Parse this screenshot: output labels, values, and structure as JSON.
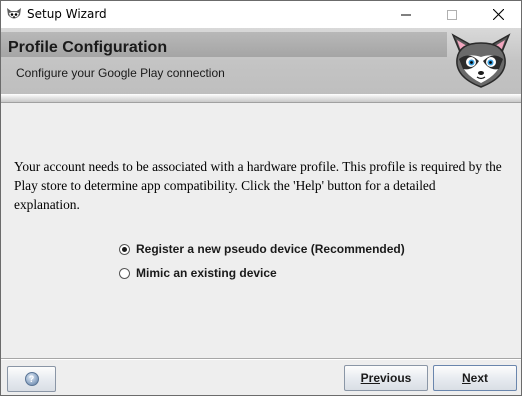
{
  "window": {
    "title": "Setup Wizard"
  },
  "header": {
    "title": "Profile Configuration",
    "subtitle": "Configure your Google Play connection"
  },
  "content": {
    "description": "Your account needs to be associated with a hardware profile. This profile is required by the Play store to determine app compatibility. Click the 'Help' button for a detailed explanation.",
    "options": [
      {
        "label": "Register a new pseudo device (Recommended)",
        "selected": true
      },
      {
        "label": "Mimic an existing device",
        "selected": false
      }
    ]
  },
  "footer": {
    "help_symbol": "?",
    "previous_mnemonic": "",
    "previous_underlined": "Pre",
    "previous_rest": "vious",
    "next_underlined": "N",
    "next_rest": "ext"
  },
  "icons": {
    "app": "raccoon-app-icon",
    "mascot": "raccoon-mascot-icon",
    "help": "help-icon",
    "minimize": "minimize-icon",
    "maximize": "maximize-icon",
    "close": "close-icon"
  },
  "colors": {
    "banner": "#c4c4c4",
    "banner_strip": "#a5a5a5",
    "window_bg": "#eeeeee"
  }
}
